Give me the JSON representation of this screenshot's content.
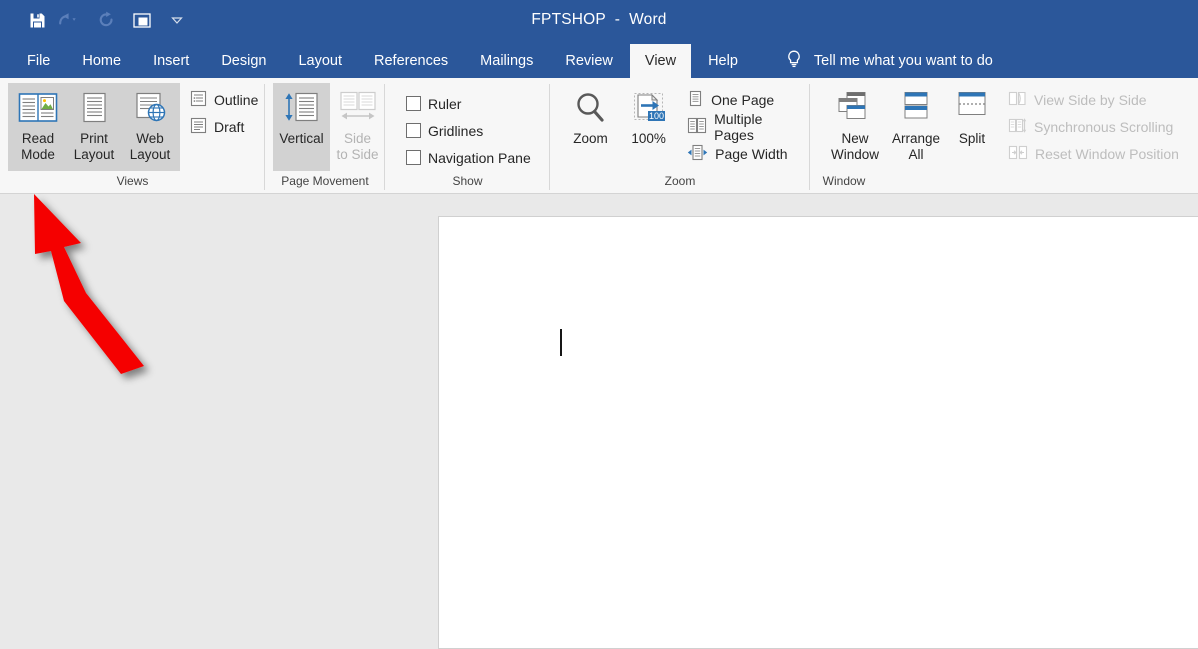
{
  "titlebar": {
    "doc_name": "FPTSHOP",
    "separator": "-",
    "app_name": "Word",
    "full_title": "FPTSHOP  -  Word",
    "accent_color": "#2b579a",
    "quick_access": [
      {
        "name": "save-icon",
        "label": "Save",
        "enabled": true
      },
      {
        "name": "undo-icon",
        "label": "Undo",
        "enabled": false
      },
      {
        "name": "redo-icon",
        "label": "Repeat",
        "enabled": false
      },
      {
        "name": "touch-mouse-mode-icon",
        "label": "Touch/Mouse Mode",
        "enabled": true
      },
      {
        "name": "chevron-down-icon",
        "label": "Customize Quick Access Toolbar",
        "enabled": true
      }
    ]
  },
  "tabs": [
    {
      "label": "File",
      "active": false
    },
    {
      "label": "Home",
      "active": false
    },
    {
      "label": "Insert",
      "active": false
    },
    {
      "label": "Design",
      "active": false
    },
    {
      "label": "Layout",
      "active": false
    },
    {
      "label": "References",
      "active": false
    },
    {
      "label": "Mailings",
      "active": false
    },
    {
      "label": "Review",
      "active": false
    },
    {
      "label": "View",
      "active": true
    },
    {
      "label": "Help",
      "active": false
    }
  ],
  "tellme": {
    "icon": "lightbulb-icon",
    "label": "Tell me what you want to do"
  },
  "ribbon": {
    "groups": [
      {
        "id": "views",
        "label": "Views",
        "big_buttons": [
          {
            "id": "read-mode",
            "line1": "Read",
            "line2": "Mode",
            "icon": "read-mode-icon",
            "highlighted": true,
            "enabled": true
          },
          {
            "id": "print-layout",
            "line1": "Print",
            "line2": "Layout",
            "icon": "print-layout-icon",
            "highlighted": true,
            "enabled": true
          },
          {
            "id": "web-layout",
            "line1": "Web",
            "line2": "Layout",
            "icon": "web-layout-icon",
            "highlighted": true,
            "enabled": true
          }
        ],
        "small_items": [
          {
            "id": "outline",
            "label": "Outline",
            "icon": "outline-icon",
            "enabled": true
          },
          {
            "id": "draft",
            "label": "Draft",
            "icon": "draft-icon",
            "enabled": true
          }
        ]
      },
      {
        "id": "page-movement",
        "label": "Page Movement",
        "big_buttons": [
          {
            "id": "vertical",
            "line1": "Vertical",
            "line2": "",
            "icon": "vertical-scroll-icon",
            "highlighted": true,
            "enabled": true
          },
          {
            "id": "side-to-side",
            "line1": "Side",
            "line2": "to Side",
            "icon": "side-to-side-icon",
            "highlighted": false,
            "enabled": false
          }
        ],
        "small_items": []
      },
      {
        "id": "show",
        "label": "Show",
        "big_buttons": [],
        "small_items": [
          {
            "id": "ruler",
            "label": "Ruler",
            "checked": false,
            "enabled": true
          },
          {
            "id": "gridlines",
            "label": "Gridlines",
            "checked": false,
            "enabled": true
          },
          {
            "id": "navigation-pane",
            "label": "Navigation Pane",
            "checked": false,
            "enabled": true
          }
        ]
      },
      {
        "id": "zoom",
        "label": "Zoom",
        "big_buttons": [
          {
            "id": "zoom",
            "line1": "Zoom",
            "line2": "",
            "icon": "magnifier-icon",
            "highlighted": false,
            "enabled": true
          },
          {
            "id": "zoom-100",
            "line1": "100%",
            "line2": "",
            "icon": "zoom-100-icon",
            "highlighted": false,
            "enabled": true
          }
        ],
        "small_items": [
          {
            "id": "one-page",
            "label": "One Page",
            "icon": "one-page-icon",
            "enabled": true
          },
          {
            "id": "multiple-pages",
            "label": "Multiple Pages",
            "icon": "multiple-pages-icon",
            "enabled": true
          },
          {
            "id": "page-width",
            "label": "Page Width",
            "icon": "page-width-icon",
            "enabled": true
          }
        ],
        "zoom_badge": "100"
      },
      {
        "id": "window",
        "label": "Window",
        "big_buttons": [
          {
            "id": "new-window",
            "line1": "New",
            "line2": "Window",
            "icon": "new-window-icon",
            "highlighted": false,
            "enabled": true
          },
          {
            "id": "arrange-all",
            "line1": "Arrange",
            "line2": "All",
            "icon": "arrange-all-icon",
            "highlighted": false,
            "enabled": true
          },
          {
            "id": "split",
            "line1": "Split",
            "line2": "",
            "icon": "split-icon",
            "highlighted": false,
            "enabled": true
          }
        ],
        "small_items": [
          {
            "id": "view-side-by-side",
            "label": "View Side by Side",
            "icon": "side-by-side-icon",
            "enabled": false
          },
          {
            "id": "synchronous-scrolling",
            "label": "Synchronous Scrolling",
            "icon": "sync-scroll-icon",
            "enabled": false
          },
          {
            "id": "reset-window-position",
            "label": "Reset Window Position",
            "icon": "reset-window-icon",
            "enabled": false
          }
        ]
      }
    ]
  },
  "document": {
    "background_color": "#e9e9e9",
    "page_color": "#ffffff",
    "caret_visible": true
  },
  "annotation": {
    "arrow_color": "#f50000",
    "points_to": "read-mode"
  }
}
